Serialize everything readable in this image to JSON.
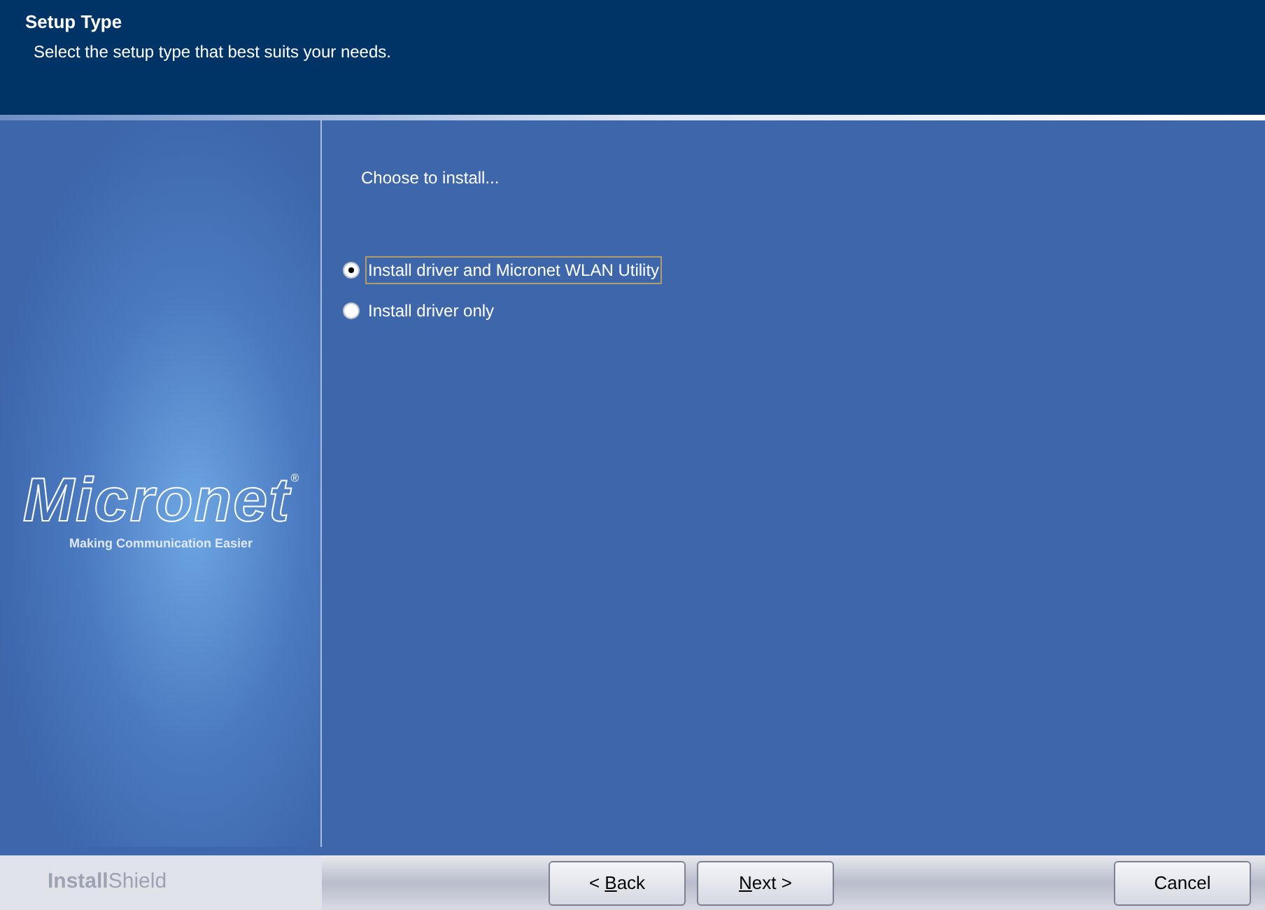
{
  "header": {
    "title": "Setup Type",
    "subtitle": "Select the setup type that best suits your needs."
  },
  "brand": {
    "logo": "Micronet",
    "registered": "®",
    "tagline": "Making Communication Easier"
  },
  "prompt": "Choose to install...",
  "options": [
    {
      "label": "Install driver and Micronet WLAN Utility",
      "selected": true,
      "focused": true
    },
    {
      "label": "Install driver only",
      "selected": false,
      "focused": false
    }
  ],
  "footer": {
    "vendor_bold": "Install",
    "vendor_light": "Shield",
    "buttons": [
      {
        "kind": "back",
        "before": "< ",
        "key": "B",
        "after": "ack"
      },
      {
        "kind": "next",
        "key": "N",
        "after": "ext >"
      },
      {
        "kind": "cancel",
        "after": "Cancel"
      }
    ]
  }
}
